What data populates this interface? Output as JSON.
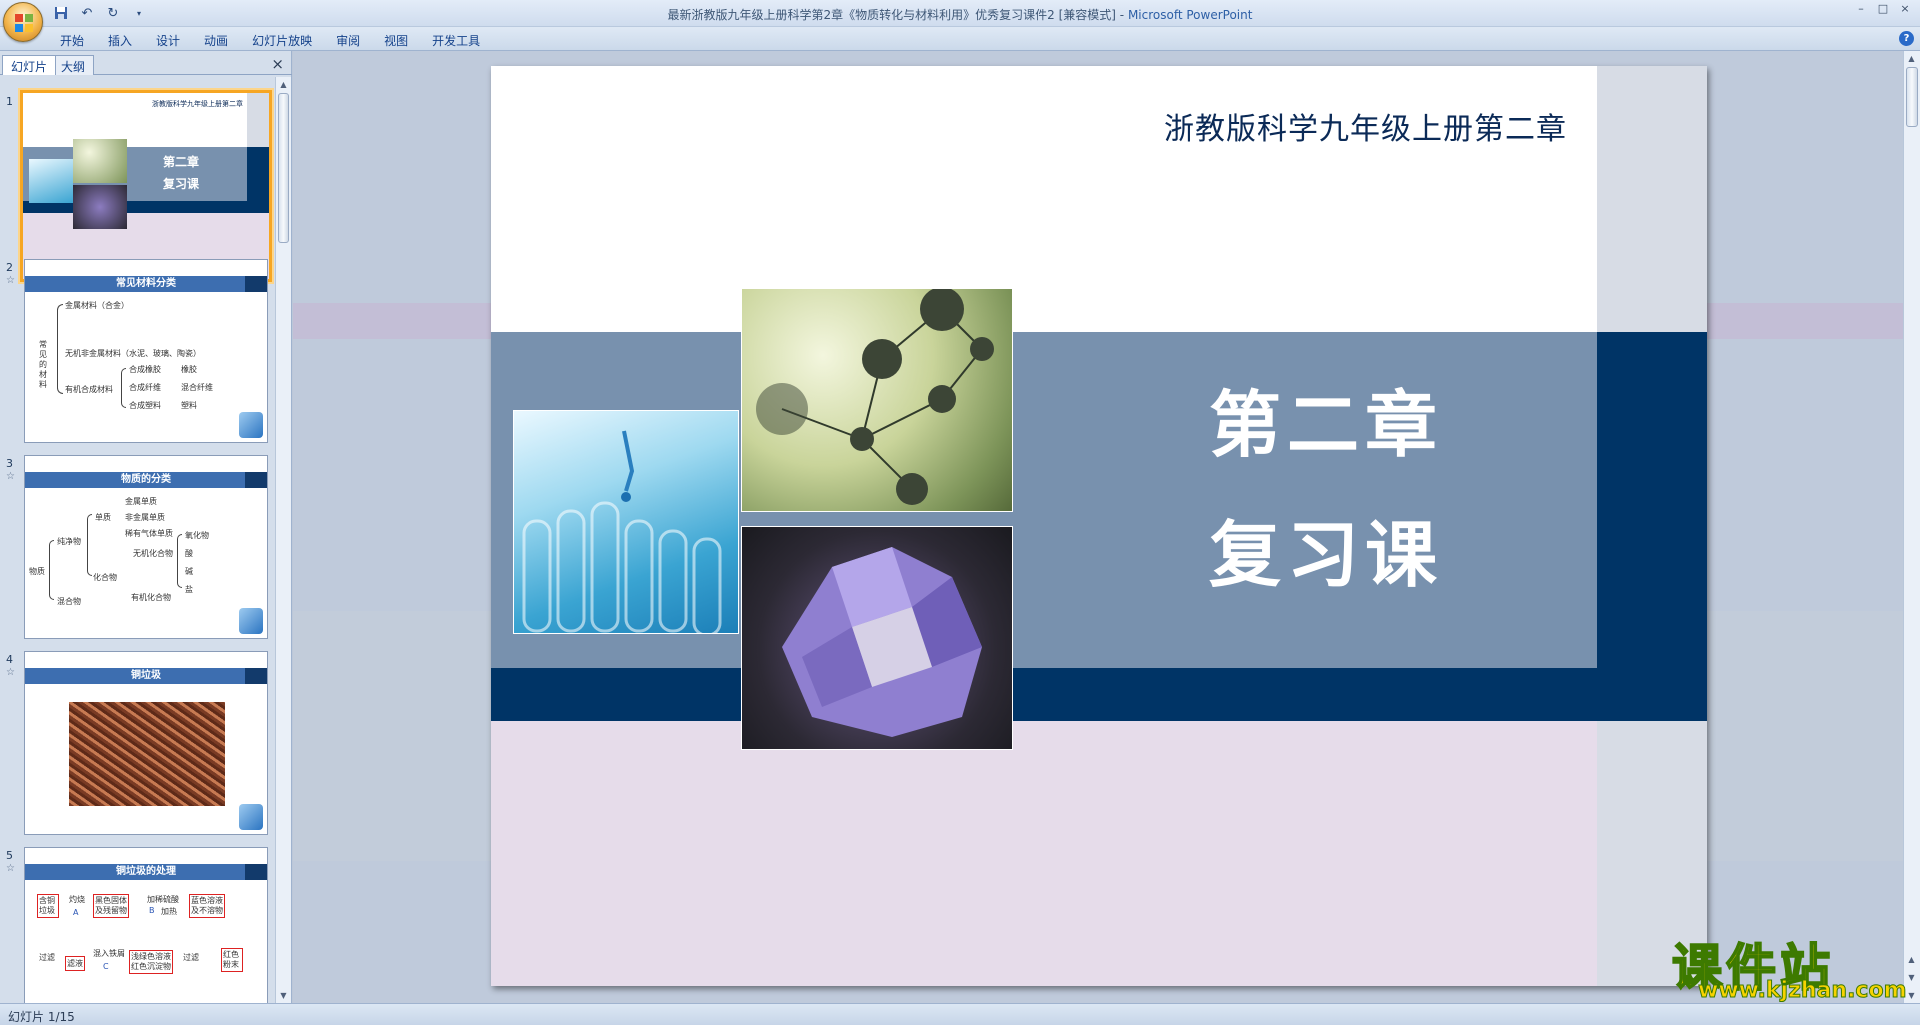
{
  "window": {
    "title": "最新浙教版九年级上册科学第2章《物质转化与材料利用》优秀复习课件2 [兼容模式] - ",
    "app_name": "Microsoft PowerPoint",
    "controls": [
      "–",
      "□",
      "×"
    ]
  },
  "quick_access": [
    "save-icon",
    "undo-icon",
    "redo-icon",
    "customize-icon"
  ],
  "ribbon": {
    "tabs": [
      "开始",
      "插入",
      "设计",
      "动画",
      "幻灯片放映",
      "审阅",
      "视图",
      "开发工具"
    ],
    "help": "?"
  },
  "left_pane": {
    "tabs": [
      "幻灯片",
      "大纲"
    ],
    "close": "×",
    "thumbnails": [
      {
        "number": "1",
        "subtitle": "浙教版科学九年级上册第二章",
        "line1": "第二章",
        "line2": "复习课"
      },
      {
        "number": "2",
        "title": "常见材料分类",
        "labels": [
          "金属材料（合金）",
          "常见的材料",
          "无机非金属材料（水泥、玻璃、陶瓷）",
          "有机合成材料",
          "合成橡胶",
          "合成纤维",
          "合成塑料",
          "橡胶",
          "混合纤维",
          "塑料"
        ]
      },
      {
        "number": "3",
        "title": "物质的分类",
        "labels": [
          "金属单质",
          "单质",
          "非金属单质",
          "稀有气体单质",
          "纯净物",
          "无机化合物",
          "氧化物",
          "酸",
          "碱",
          "盐",
          "物质",
          "化合物",
          "有机化合物",
          "混合物"
        ]
      },
      {
        "number": "4",
        "title": "铜垃圾"
      },
      {
        "number": "5",
        "title": "铜垃圾的处理",
        "labels": [
          "含铜垃圾",
          "灼烧",
          "A",
          "黑色固体及残留物",
          "加稀硫酸",
          "B",
          "加热",
          "蓝色溶液及不溶物",
          "过滤",
          "滤液",
          "混入铁屑",
          "C",
          "浅绿色溶液红色沉淀物",
          "过滤",
          "红色粉末"
        ]
      }
    ]
  },
  "slide": {
    "subtitle": "浙教版科学九年级上册第二章",
    "title_line1": "第二章",
    "title_line2": "复习课"
  },
  "watermark": {
    "title": "课件站",
    "url": "www.kjzhan.com"
  },
  "status": {
    "text": "幻灯片 1/15"
  }
}
